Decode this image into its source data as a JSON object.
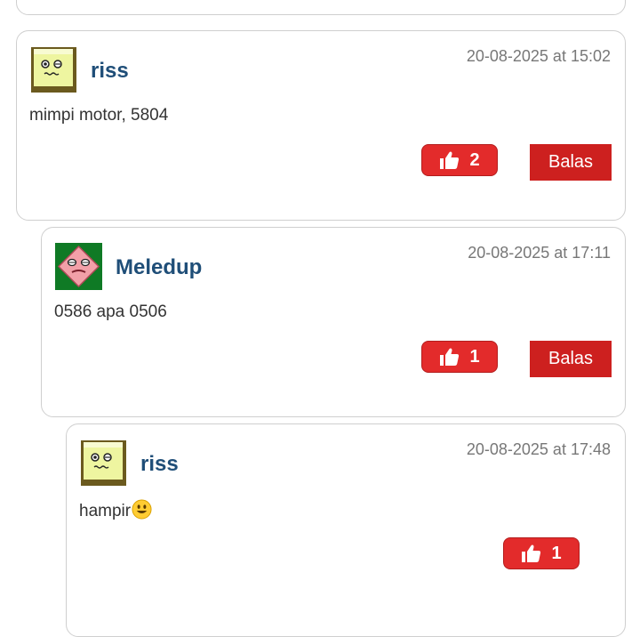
{
  "comments": [
    {
      "username": "riss",
      "date": "20-08-2025 at 15:02",
      "text": "mimpi motor, 5804",
      "likes": "2",
      "reply_label": "Balas",
      "avatar_icon": "green-square-face-avatar"
    },
    {
      "username": "Meledup",
      "date": "20-08-2025 at 17:11",
      "text": "0586 apa 0506",
      "likes": "1",
      "reply_label": "Balas",
      "avatar_icon": "pink-diamond-face-avatar"
    },
    {
      "username": "riss",
      "date": "20-08-2025 at 17:48",
      "text": "hampir",
      "emoji": "smiley-emoji",
      "likes": "1",
      "avatar_icon": "green-square-face-avatar"
    }
  ],
  "colors": {
    "like_button": "#e32b2b",
    "reply_button": "#cd201f",
    "username": "#1f4e78",
    "date": "#777777",
    "card_border": "#cfcfcf"
  },
  "icons": {
    "like": "thumbs-up-icon"
  }
}
